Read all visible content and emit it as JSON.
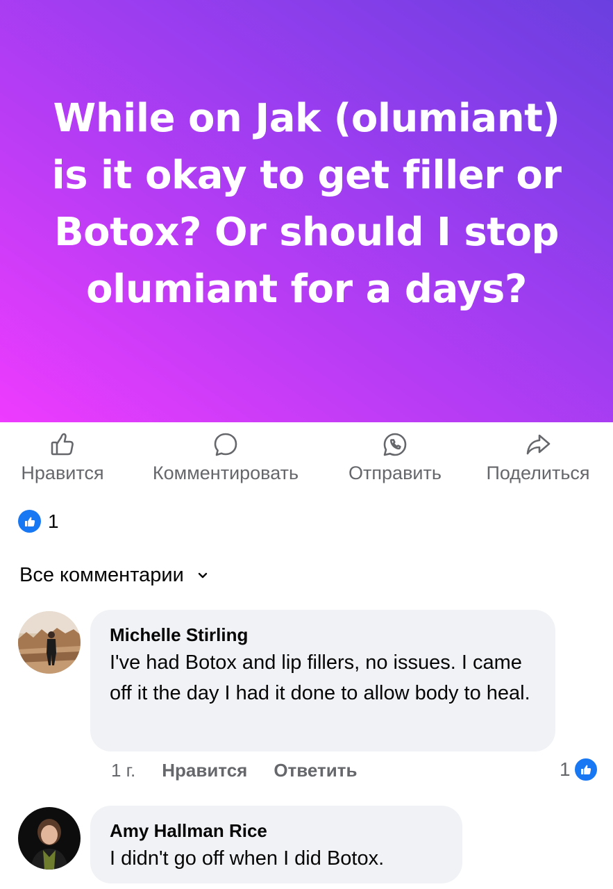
{
  "post": {
    "title": "While on Jak (olumiant) is it okay to get filler or Botox? Or should I stop olumiant for a days?"
  },
  "actions": {
    "like": "Нравится",
    "comment": "Комментировать",
    "send": "Отправить",
    "share": "Поделиться"
  },
  "reactions": {
    "count": "1"
  },
  "comments_sort": {
    "label": "Все комментарии"
  },
  "comments": [
    {
      "author": "Michelle Stirling",
      "text": "I've had Botox and lip fillers, no issues. I came off it the day I had it done to allow body to heal.",
      "time": "1 г.",
      "like_label": "Нравится",
      "reply_label": "Ответить",
      "reaction_count": "1"
    },
    {
      "author": "Amy Hallman Rice",
      "text": "I didn't go off when I did Botox."
    }
  ],
  "colors": {
    "banner_gradient": [
      "#6a3fe0",
      "#ee3bff"
    ],
    "accent": "#1877f2",
    "muted_text": "#65676b",
    "bubble": "#f0f2f5"
  }
}
